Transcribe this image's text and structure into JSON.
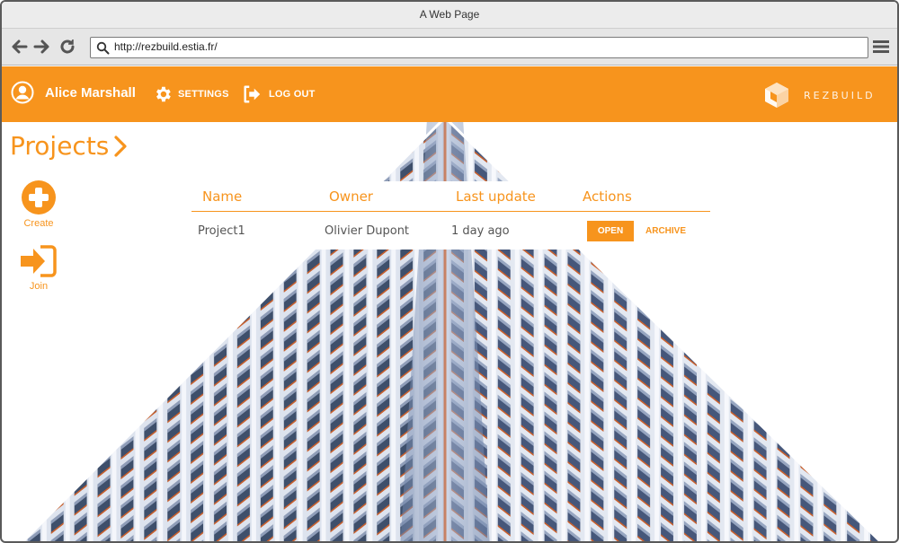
{
  "browser": {
    "title": "A Web Page",
    "url": "http://rezbuild.estia.fr/"
  },
  "header": {
    "user_name": "Alice Marshall",
    "settings_label": "SETTINGS",
    "logout_label": "LOG OUT",
    "brand_name": "REZBUILD"
  },
  "page": {
    "title": "Projects"
  },
  "sidebar": {
    "create_label": "Create",
    "join_label": "Join"
  },
  "table": {
    "columns": [
      "Name",
      "Owner",
      "Last update",
      "Actions"
    ],
    "rows": [
      {
        "name": "Project1",
        "owner": "Olivier Dupont",
        "last_update": "1 day ago",
        "open_label": "OPEN",
        "archive_label": "ARCHIVE"
      }
    ]
  },
  "colors": {
    "accent": "#f7941d",
    "chrome": "#e6e6e6"
  }
}
